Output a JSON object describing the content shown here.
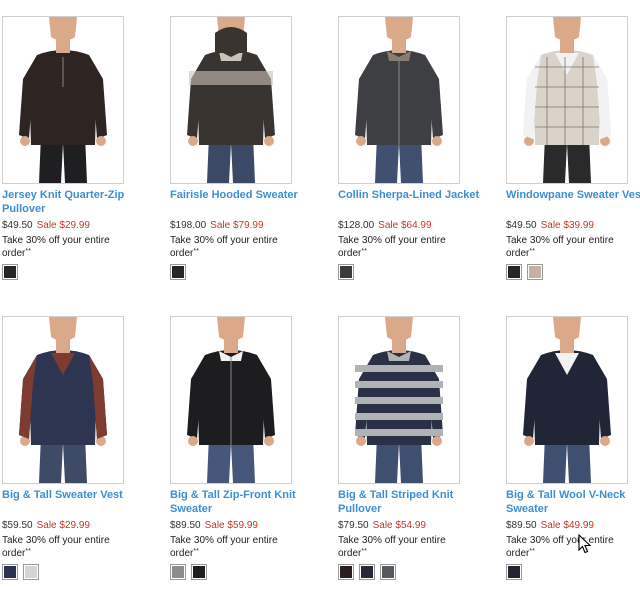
{
  "products": [
    {
      "name": "Jersey Knit Quarter-Zip Pullover",
      "price": "$49.50",
      "sale": "Sale $29.99",
      "promo": "Take 30% off your entire order",
      "promo_mark": "**",
      "swatch_colors": [
        "#262626"
      ],
      "style": {
        "shirt": "#2e2522",
        "trim": "#2e2522",
        "pants": "#1f1f22",
        "type": "quarterzip"
      }
    },
    {
      "name": "Fairisle Hooded Sweater",
      "price": "$198.00",
      "sale": "Sale $79.99",
      "promo": "Take 30% off your entire order",
      "promo_mark": "**",
      "swatch_colors": [
        "#2a2624"
      ],
      "style": {
        "shirt": "#3a3431",
        "trim": "#c9c2b8",
        "pants": "#3a4a66",
        "type": "fairisle"
      }
    },
    {
      "name": "Collin Sherpa-Lined Jacket",
      "price": "$128.00",
      "sale": "Sale $64.99",
      "promo": "Take 30% off your entire order",
      "promo_mark": "**",
      "swatch_colors": [
        "#3b3b3b"
      ],
      "style": {
        "shirt": "#3d3f42",
        "trim": "#8a7d6e",
        "pants": "#3f5070",
        "type": "jacket"
      }
    },
    {
      "name": "Windowpane Sweater Vest",
      "price": "$49.50",
      "sale": "Sale $39.99",
      "promo": "Take 30% off your entire order",
      "promo_mark": "**",
      "swatch_colors": [
        "#26272d",
        "#c4b2a6"
      ],
      "style": {
        "shirt": "#d9d3c9",
        "trim": "#f2f2f2",
        "pants": "#2a2a2a",
        "type": "vest"
      }
    },
    {
      "name": "Big & Tall Sweater Vest",
      "price": "$59.50",
      "sale": "Sale $29.99",
      "promo": "Take 30% off your entire order",
      "promo_mark": "**",
      "swatch_colors": [
        "#2c3350",
        "#d4d4d4"
      ],
      "style": {
        "shirt": "#2d3550",
        "trim": "#7e3b30",
        "pants": "#3d4b66",
        "type": "vestplaid"
      }
    },
    {
      "name": "Big & Tall Zip-Front Knit Sweater",
      "price": "$89.50",
      "sale": "Sale $59.99",
      "promo": "Take 30% off your entire order",
      "promo_mark": "**",
      "swatch_colors": [
        "#8c8c8c",
        "#1e1e1e"
      ],
      "style": {
        "shirt": "#1d1d1f",
        "trim": "#f2f2f2",
        "pants": "#45577a",
        "type": "zipfront"
      }
    },
    {
      "name": "Big & Tall Striped Knit Pullover",
      "price": "$79.50",
      "sale": "Sale $54.99",
      "promo": "Take 30% off your entire order",
      "promo_mark": "**",
      "swatch_colors": [
        "#2b1e1e",
        "#262a38",
        "#555a5e"
      ],
      "style": {
        "shirt": "#2a3046",
        "trim": "#b0b3b6",
        "pants": "#3e5070",
        "type": "striped"
      }
    },
    {
      "name": "Big & Tall Wool V-Neck Sweater",
      "price": "$89.50",
      "sale": "Sale $49.99",
      "promo": "Take 30% off your entire order",
      "promo_mark": "**",
      "swatch_colors": [
        "#22252f"
      ],
      "style": {
        "shirt": "#212637",
        "trim": "#f2f2f2",
        "pants": "#3e5070",
        "type": "vneck"
      }
    }
  ]
}
